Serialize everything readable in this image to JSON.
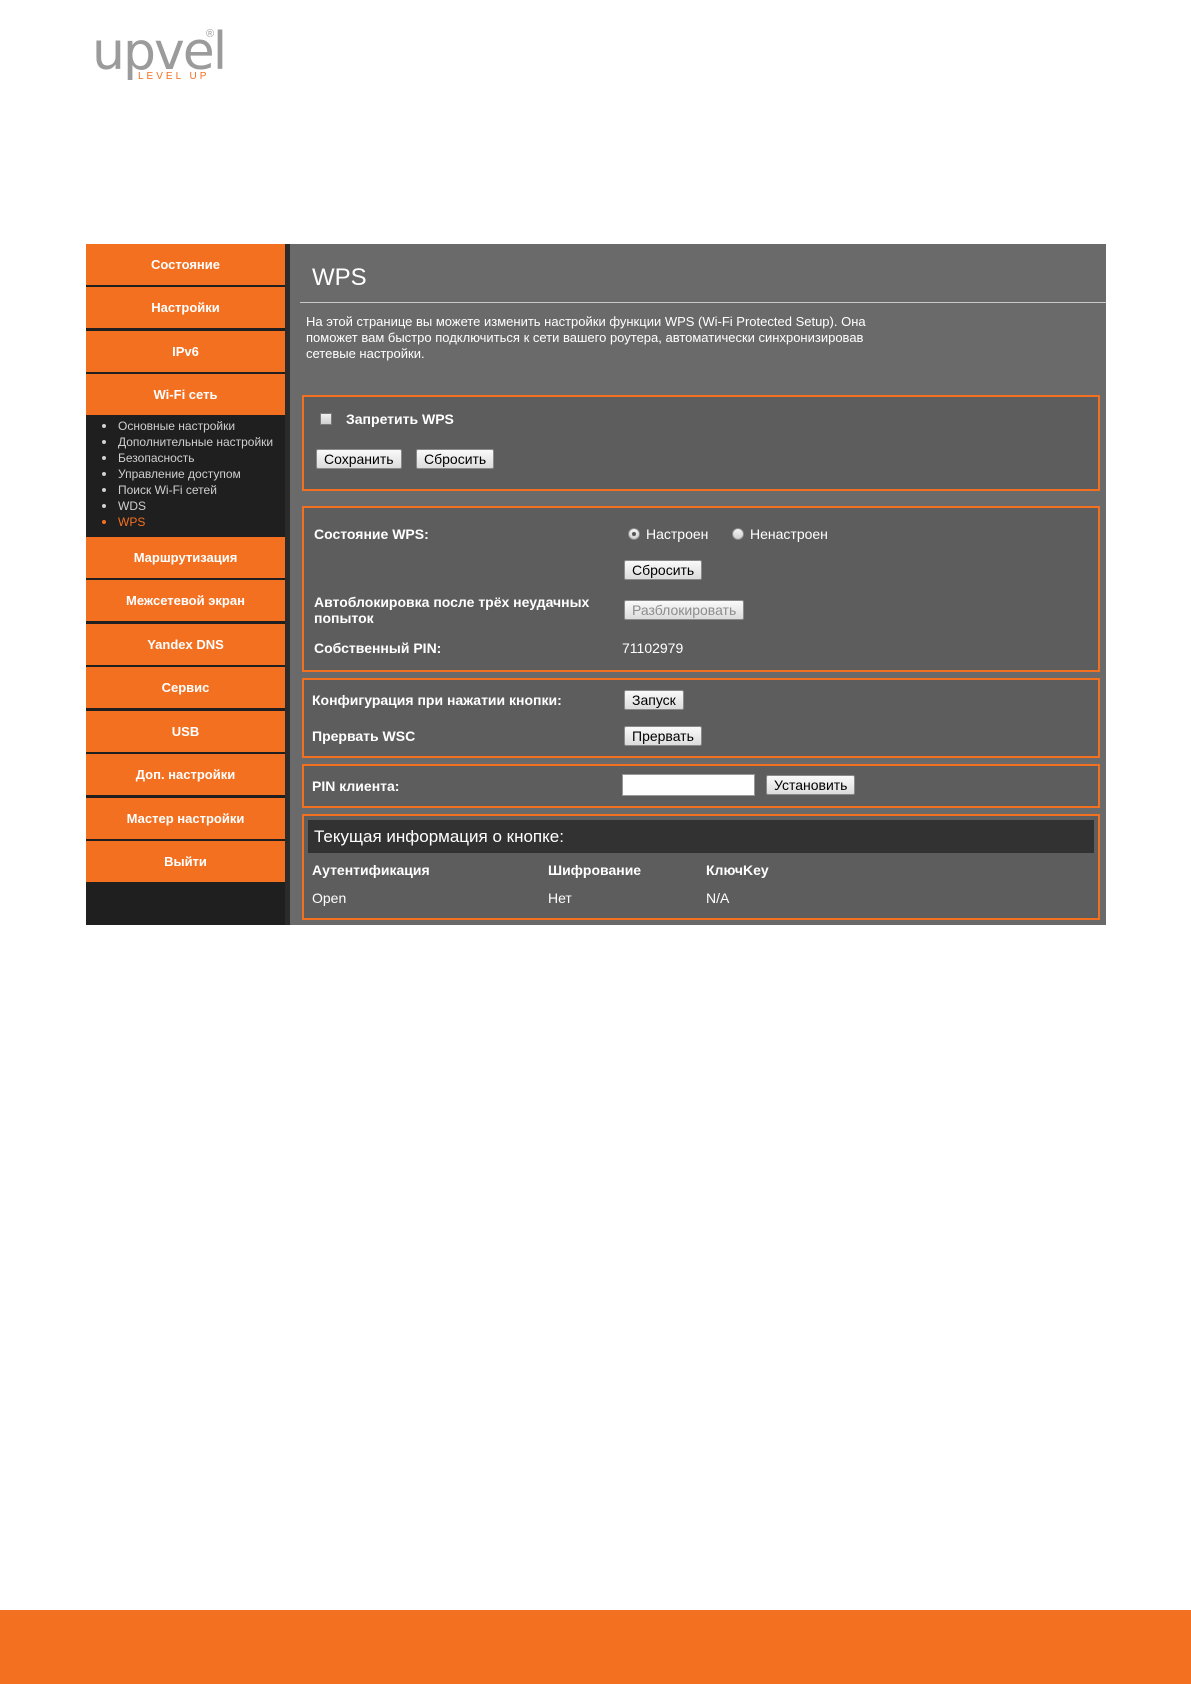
{
  "logo": {
    "word": "upvel",
    "reg": "®",
    "tagline": "LEVEL UP"
  },
  "sidebar": {
    "nav_top": [
      "Состояние",
      "Настройки",
      "IPv6",
      "Wi-Fi сеть"
    ],
    "submenu": [
      "Основные настройки",
      "Дополнительные настройки",
      "Безопасность",
      "Управление доступом",
      "Поиск Wi-Fi сетей",
      "WDS",
      "WPS"
    ],
    "active_submenu": "WPS",
    "nav_bottom": [
      "Маршрутизация",
      "Межсетевой экран",
      "Yandex DNS",
      "Сервис",
      "USB",
      "Доп. настройки",
      "Мастер настройки",
      "Выйти"
    ]
  },
  "page": {
    "title": "WPS",
    "description": "На этой странице вы можете изменить настройки функции WPS (Wi-Fi Protected Setup). Она поможет вам быстро подключиться к сети вашего роутера, автоматически синхронизировав сетевые настройки."
  },
  "disable_panel": {
    "checkbox_label": "Запретить WPS",
    "checked": false,
    "save_label": "Сохранить",
    "reset_label": "Сбросить"
  },
  "status_panel": {
    "state_label": "Состояние WPS:",
    "radio_configured": "Настроен",
    "radio_unconfigured": "Ненастроен",
    "selected": "Настроен",
    "reset_label": "Сбросить",
    "autolock_label": "Автоблокировка после трёх неудачных попыток",
    "unlock_label": "Разблокировать",
    "pin_label": "Собственный PIN:",
    "pin_value": "71102979"
  },
  "pbc_panel": {
    "config_label": "Конфигурация при нажатии кнопки:",
    "start_label": "Запуск",
    "abort_label": "Прервать WSC",
    "abort_button": "Прервать"
  },
  "client_pin_panel": {
    "label": "PIN клиента:",
    "value": "",
    "set_label": "Установить"
  },
  "info_panel": {
    "title": "Текущая информация о кнопке:",
    "columns": [
      "Аутентификация",
      "Шифрование",
      "КлючKey"
    ],
    "row": [
      "Open",
      "Нет",
      "N/A"
    ]
  },
  "colors": {
    "accent": "#f37021",
    "content_bg": "#6a6a6a",
    "sidebar_bg": "#1f1f1f"
  }
}
